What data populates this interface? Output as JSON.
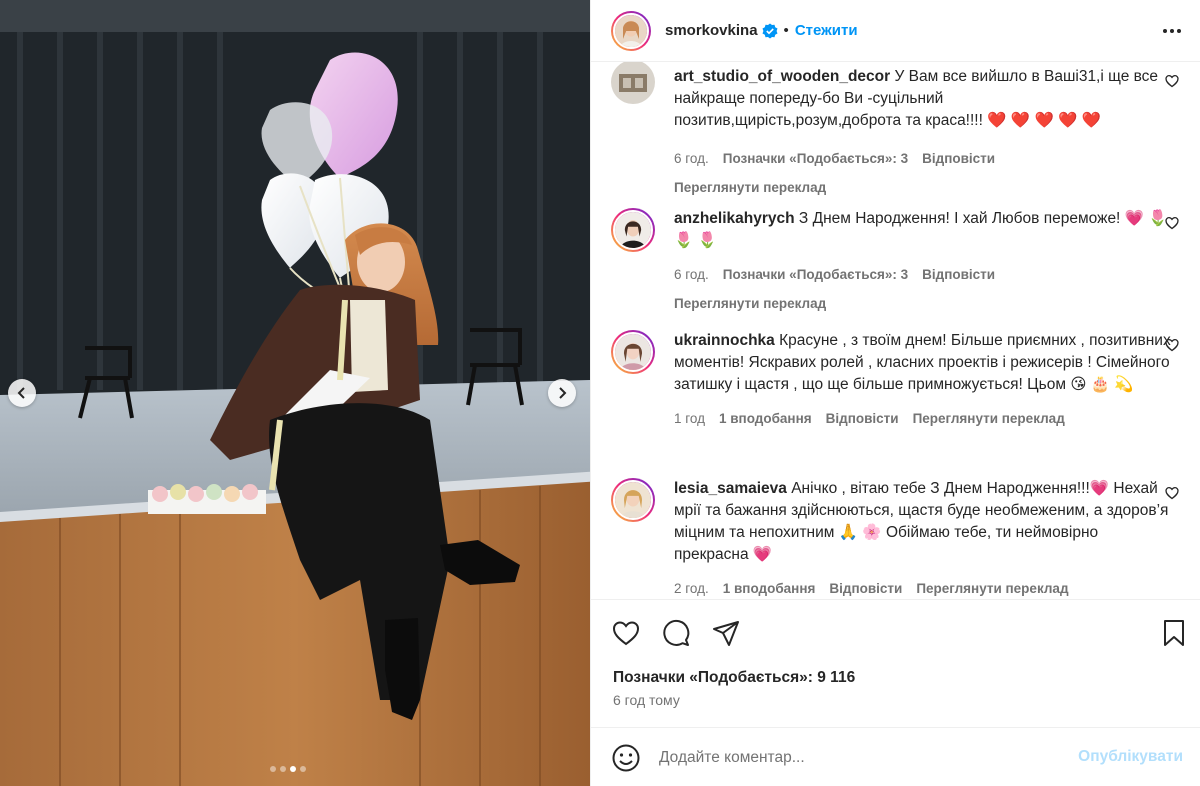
{
  "post": {
    "author": "smorkovkina",
    "follow_label": "Стежити",
    "separator": "•",
    "carousel": {
      "count": 4,
      "active": 3
    }
  },
  "comments": [
    {
      "user": "art_studio_of_wooden_decor",
      "text": "У Вам все вийшло в Ваші31,і ще все найкраще попереду-бо Ви -суцільний позитив,щирість,розум,доброта та краса!!!!",
      "emoji": "❤️ ❤️ ❤️ ❤️ ❤️",
      "time": "6 год.",
      "likes": "Позначки «Подобається»: 3",
      "reply": "Відповісти",
      "translate": "Переглянути переклад"
    },
    {
      "user": "anzhelikahyrych",
      "text": "З Днем Народження! І хай Любов переможе!",
      "emoji": "💗 🌷 🌷 🌷",
      "time": "6 год.",
      "likes": "Позначки «Подобається»: 3",
      "reply": "Відповісти",
      "translate": "Переглянути переклад"
    },
    {
      "user": "ukrainnochka",
      "text": "Красуне , з твоїм днем! Більше приємних , позитивних моментів! Яскравих ролей , класних проектів і режисерів ! Сімейного затишку і щастя , що ще більше примножується! Цьом",
      "emoji": "😘 🎂 💫",
      "time": "1 год",
      "likes": "1 вподобання",
      "reply": "Відповісти",
      "translate": "Переглянути переклад"
    },
    {
      "user": "lesia_samaieva",
      "text": "Анічко , вітаю тебе З Днем Народження!!!",
      "emoji_inline": "💗",
      "text2": "Нехай мрії та бажання здійснюються, щастя буде необмеженим, а здоров’я міцним та непохитним",
      "emoji2": "🙏 🌸",
      "text3": "Обіймаю тебе, ти неймовірно прекрасна",
      "emoji3": "💗",
      "time": "2 год.",
      "likes": "1 вподобання",
      "reply": "Відповісти",
      "translate": "Переглянути переклад"
    }
  ],
  "footer": {
    "likes": "Позначки «Подобається»: 9 116",
    "time": "6 год тому",
    "comment_placeholder": "Додайте коментар...",
    "publish_label": "Опублікувати"
  },
  "colors": {
    "accent": "#0095f6",
    "publish_disabled": "#b2dffc",
    "muted": "#737373",
    "text": "#262626"
  },
  "icons": [
    "verified-icon",
    "more-icon",
    "like-icon",
    "comment-icon",
    "share-icon",
    "save-icon",
    "emoji-icon",
    "prev-icon",
    "next-icon"
  ]
}
